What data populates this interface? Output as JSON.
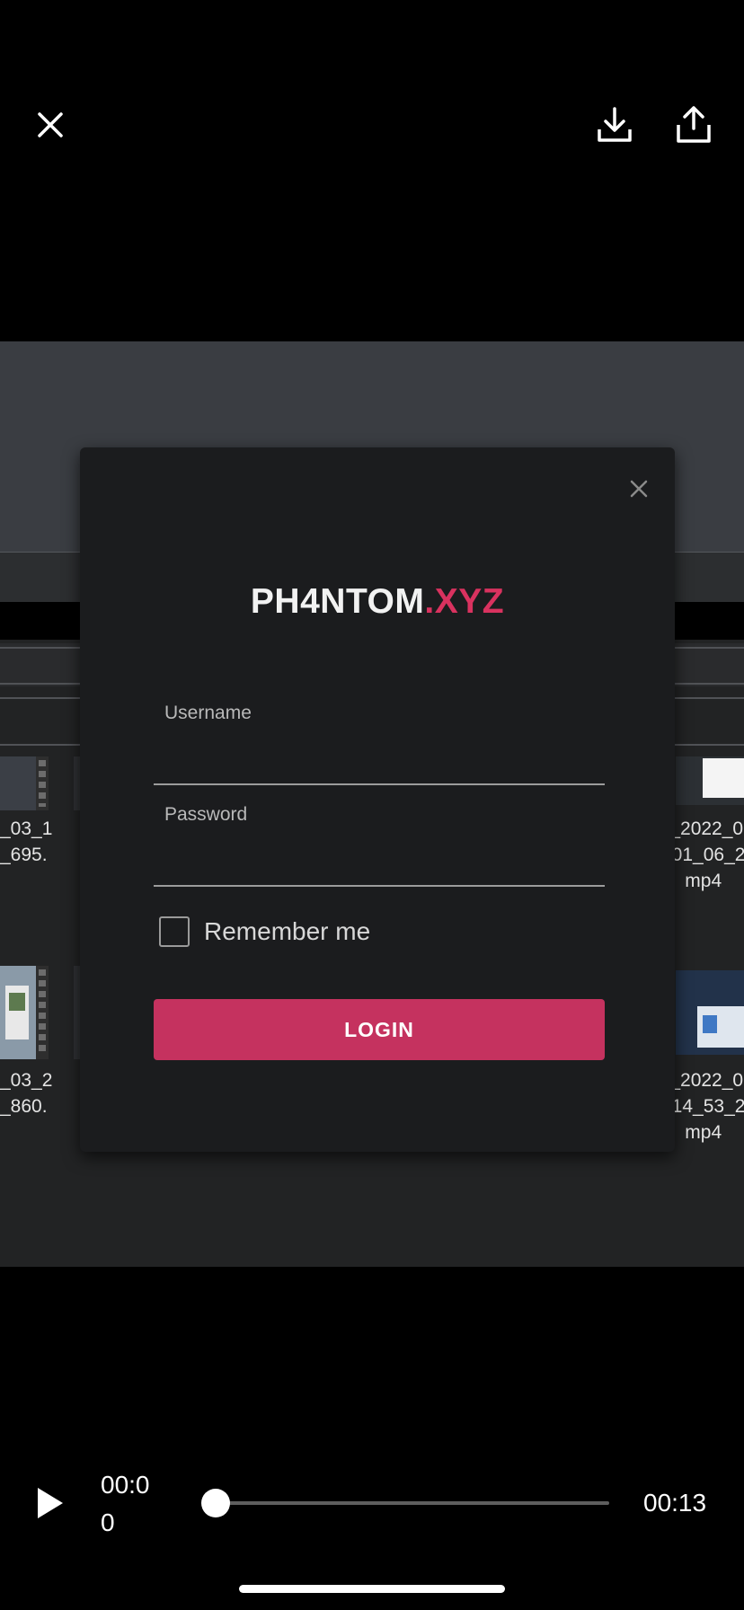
{
  "top_bar": {
    "close_icon": "close-icon",
    "download_icon": "download-icon",
    "share_icon": "share-icon"
  },
  "video_frame": {
    "file_names": [
      "_03_1\n_695.",
      "r_2022_0\n_01_06_2\nmp4",
      "_03_2\n_860.",
      "r_2022_0\n_14_53_2\nmp4"
    ]
  },
  "login_dialog": {
    "close_glyph": "X",
    "brand_part1": "PH4NTOM",
    "brand_part2": ".XYZ",
    "username_label": "Username",
    "password_label": "Password",
    "username_value": "",
    "password_value": "",
    "remember_label": "Remember me",
    "remember_checked": false,
    "login_label": "LOGIN",
    "accent_color": "#c5325f"
  },
  "player": {
    "current_time": "00:0\n0",
    "duration": "00:13",
    "progress": 0.0,
    "play_icon": "play-icon"
  }
}
